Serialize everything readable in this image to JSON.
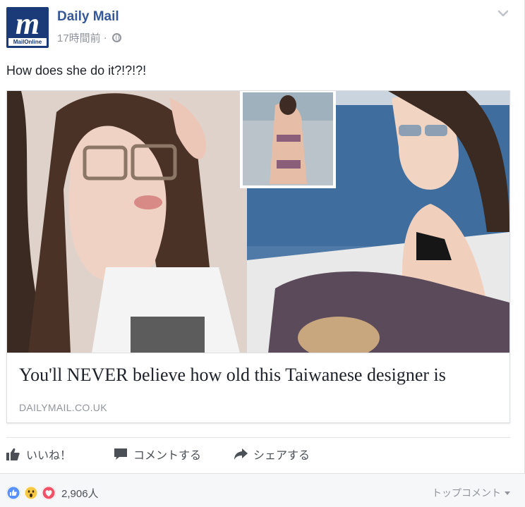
{
  "header": {
    "page_name": "Daily Mail",
    "avatar_letter": "m",
    "avatar_tag": "MailOnline",
    "timestamp": "17時間前",
    "separator": "·",
    "privacy_icon": "globe-icon",
    "menu_icon": "chevron-down-icon"
  },
  "post": {
    "text": "How does she do it?!?!?!"
  },
  "link_card": {
    "title": "You'll NEVER believe how old this Taiwanese designer is",
    "domain": "DAILYMAIL.CO.UK",
    "image_description_icon": "photo-collage"
  },
  "actions": {
    "like_label": "いいね！",
    "comment_label": "コメントする",
    "share_label": "シェアする"
  },
  "reactions": {
    "count": "2,906人",
    "types": [
      "like",
      "wow",
      "love"
    ]
  },
  "comments": {
    "sort_label": "トップコメント"
  },
  "colors": {
    "facebook_blue": "#365899",
    "brand_navy": "#1a3a78",
    "meta_gray": "#90949c",
    "like_blue": "#5890ff",
    "wow_yellow": "#f7c844",
    "love_red": "#f25268"
  }
}
